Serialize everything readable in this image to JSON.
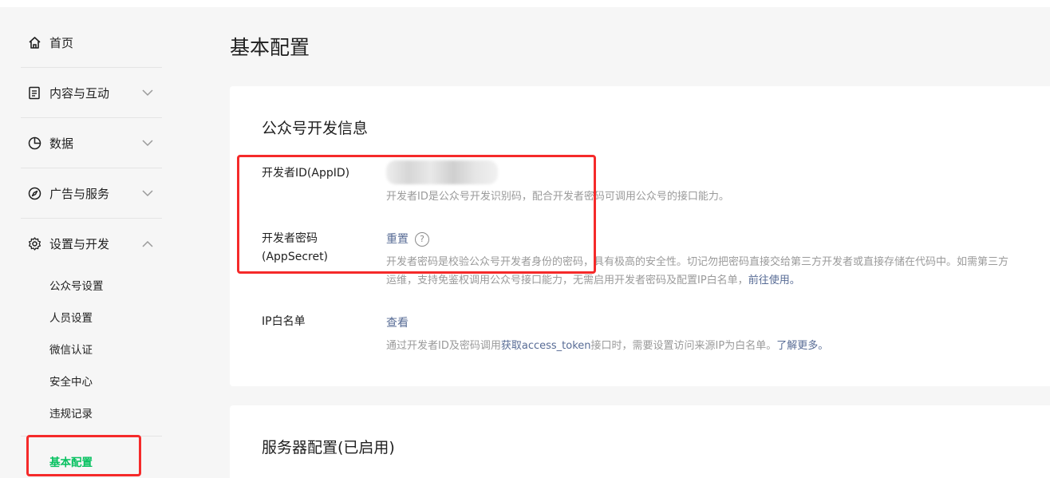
{
  "sidebar": {
    "home": "首页",
    "content": "内容与互动",
    "data": "数据",
    "ads": "广告与服务",
    "settings": "设置与开发",
    "sub_items": [
      "公众号设置",
      "人员设置",
      "微信认证",
      "安全中心",
      "违规记录"
    ],
    "active_item": "基本配置"
  },
  "main": {
    "page_title": "基本配置",
    "dev_info": {
      "title": "公众号开发信息",
      "appid_label": "开发者ID(AppID)",
      "appid_desc": "开发者ID是公众号开发识别码，配合开发者密码可调用公众号的接口能力。",
      "secret_label": "开发者密码(AppSecret)",
      "secret_reset": "重置",
      "help": "?",
      "secret_desc_line1": "开发者密码是校验公众号开发者身份的密码，具有极高的安全性。切记勿把密码直接交给第三方开发者或直接存储在代码中。如需第三方",
      "secret_desc_line2_prefix": "运维，支持免鉴权调用公众号接口能力，无需启用开发者密码及配置IP白名单，",
      "secret_desc_line2_link": "前往使用。",
      "ip_label": "IP白名单",
      "ip_view": "查看",
      "ip_desc_prefix": "通过开发者ID及密码调用",
      "ip_desc_link1": "获取access_token",
      "ip_desc_middle": "接口时，需要设置访问来源IP为白名单。",
      "ip_desc_link2": "了解更多。"
    },
    "server_config": {
      "title": "服务器配置(已启用)"
    }
  },
  "colors": {
    "accent_green": "#07c160",
    "link_blue": "#576b95",
    "annotation_red": "#f52a2a"
  }
}
